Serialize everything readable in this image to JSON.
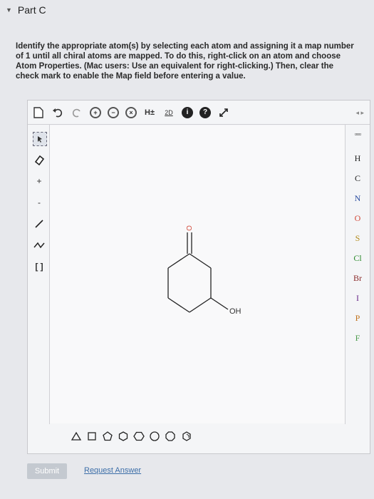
{
  "part": {
    "title": "Part C"
  },
  "instructions": "Identify the appropriate atom(s) by selecting each atom and assigning it a map number of 1 until all chiral atoms are mapped. To do this, right-click on an atom and choose Atom Properties. (Mac users: Use an equivalent for right-clicking.) Then, clear the check mark to enable the Map field before entering a value.",
  "toolbar": {
    "tools": [
      "new-document",
      "undo",
      "redo",
      "zoom-in",
      "zoom-out",
      "zoom-fit",
      "add-hydrogens",
      "2d-clean",
      "info",
      "help",
      "expand"
    ],
    "h_label": "H±",
    "clean_label": "2D",
    "info_label": "i",
    "help_label": "?"
  },
  "left_tools": [
    "select",
    "erase",
    "charge-plus",
    "charge-minus",
    "single-bond",
    "chain",
    "bracket"
  ],
  "left_labels": {
    "plus": "+",
    "minus": "-"
  },
  "elements": [
    "H",
    "C",
    "N",
    "O",
    "S",
    "Cl",
    "Br",
    "I",
    "P",
    "F"
  ],
  "molecule": {
    "carbonyl_label": "O",
    "hydroxyl_label": "OH"
  },
  "shapes": [
    "triangle",
    "square",
    "pentagon",
    "hexagon-1",
    "hexagon-2",
    "heptagon",
    "octagon",
    "benzene"
  ],
  "buttons": {
    "submit": "Submit",
    "request_answer": "Request Answer"
  },
  "colors": {
    "link": "#3c6ea8",
    "submit_bg": "#c4c9d0",
    "carbonyl_O": "#d24a3a"
  }
}
